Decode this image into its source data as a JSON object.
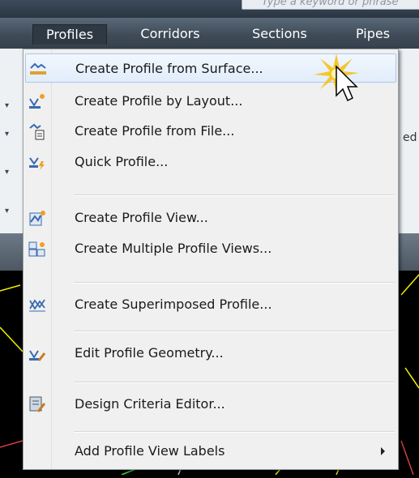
{
  "search": {
    "placeholder": "Type a keyword or phrase"
  },
  "menubar": {
    "tabs": [
      {
        "label": "Profiles"
      },
      {
        "label": "Corridors"
      },
      {
        "label": "Sections"
      },
      {
        "label": "Pipes"
      }
    ],
    "active_tab": "Profiles"
  },
  "background": {
    "right_fragment_1": "ed"
  },
  "dropdown": {
    "items": [
      {
        "label": "Create Profile from Surface...",
        "icon": "profile-from-surface-icon",
        "state": "hover"
      },
      {
        "label": "Create Profile by Layout...",
        "icon": "profile-by-layout-icon"
      },
      {
        "label": "Create Profile from File...",
        "icon": "profile-from-file-icon"
      },
      {
        "label": "Quick Profile...",
        "icon": "quick-profile-icon"
      },
      {
        "label": "Create Profile View...",
        "icon": "profile-view-icon"
      },
      {
        "label": "Create Multiple Profile Views...",
        "icon": "multiple-profile-views-icon"
      },
      {
        "label": "Create Superimposed Profile...",
        "icon": "superimposed-profile-icon"
      },
      {
        "label": "Edit Profile Geometry...",
        "icon": "edit-profile-geometry-icon"
      },
      {
        "label": "Design Criteria Editor...",
        "icon": "design-criteria-editor-icon"
      },
      {
        "label": "Add Profile View Labels",
        "icon": "",
        "has_submenu": true
      }
    ]
  },
  "colors": {
    "hover_bg": "#e1edfb",
    "hover_border": "#a9c7ec",
    "menubar": "#3f4b58",
    "highlight_star": "#f5c21b"
  }
}
